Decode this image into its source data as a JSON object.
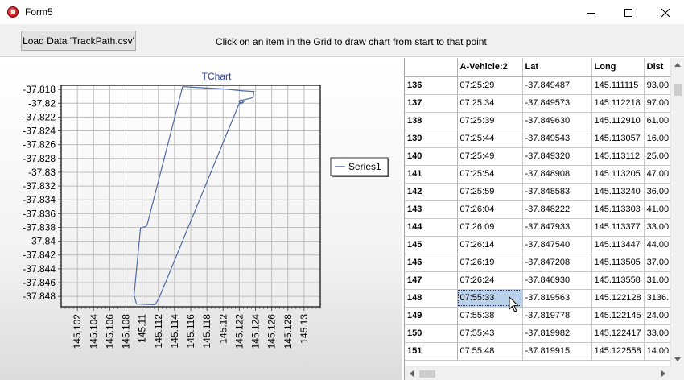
{
  "window": {
    "title": "Form5",
    "controls": {
      "minimize": "minimize-icon",
      "maximize": "maximize-icon",
      "close": "close-icon"
    }
  },
  "toolbar": {
    "load_label": "Load Data 'TrackPath.csv'",
    "hint": "Click on an item in the Grid to draw chart from start to that point"
  },
  "chart_data": {
    "type": "line",
    "title": "TChart",
    "legend": {
      "placement": "right",
      "entries": [
        "Series1"
      ]
    },
    "xlim": [
      145.1,
      145.132
    ],
    "ylim": [
      -37.8495,
      -37.8174
    ],
    "xticks": [
      "145.102",
      "145.104",
      "145.106",
      "145.108",
      "145.11",
      "145.112",
      "145.114",
      "145.116",
      "145.118",
      "145.12",
      "145.122",
      "145.124",
      "145.126",
      "145.128",
      "145.13"
    ],
    "yticks": [
      "-37.818",
      "-37.82",
      "-37.822",
      "-37.824",
      "-37.826",
      "-37.828",
      "-37.83",
      "-37.832",
      "-37.834",
      "-37.836",
      "-37.838",
      "-37.84",
      "-37.842",
      "-37.844",
      "-37.846",
      "-37.848"
    ],
    "grid": true,
    "line_color": "#4f6aa6",
    "series": [
      {
        "name": "Series1",
        "points": [
          [
            145.115,
            -37.8176
          ],
          [
            145.1198,
            -37.8179
          ],
          [
            145.1225,
            -37.8182
          ],
          [
            145.1238,
            -37.8183
          ],
          [
            145.1237,
            -37.8192
          ],
          [
            145.1222,
            -37.8196
          ],
          [
            145.1221,
            -37.82
          ],
          [
            145.1226,
            -37.8198
          ],
          [
            145.122,
            -37.82
          ],
          [
            145.1121,
            -37.8482
          ],
          [
            145.1116,
            -37.8492
          ],
          [
            145.1093,
            -37.8491
          ],
          [
            145.109,
            -37.8478
          ],
          [
            145.1098,
            -37.8381
          ],
          [
            145.1104,
            -37.8379
          ],
          [
            145.1106,
            -37.8377
          ],
          [
            145.115,
            -37.8176
          ]
        ]
      }
    ]
  },
  "grid": {
    "headers": [
      "",
      "A-Vehicle:2",
      "Lat",
      "Long",
      "Dist"
    ],
    "rows": [
      [
        "136",
        "07:25:29",
        "-37.849487",
        "145.111115",
        "93.00"
      ],
      [
        "137",
        "07:25:34",
        "-37.849573",
        "145.112218",
        "97.00"
      ],
      [
        "138",
        "07:25:39",
        "-37.849630",
        "145.112910",
        "61.00"
      ],
      [
        "139",
        "07:25:44",
        "-37.849543",
        "145.113057",
        "16.00"
      ],
      [
        "140",
        "07:25:49",
        "-37.849320",
        "145.113112",
        "25.00"
      ],
      [
        "141",
        "07:25:54",
        "-37.848908",
        "145.113205",
        "47.00"
      ],
      [
        "142",
        "07:25:59",
        "-37.848583",
        "145.113240",
        "36.00"
      ],
      [
        "143",
        "07:26:04",
        "-37.848222",
        "145.113303",
        "41.00"
      ],
      [
        "144",
        "07:26:09",
        "-37.847933",
        "145.113377",
        "33.00"
      ],
      [
        "145",
        "07:26:14",
        "-37.847540",
        "145.113447",
        "44.00"
      ],
      [
        "146",
        "07:26:19",
        "-37.847208",
        "145.113505",
        "37.00"
      ],
      [
        "147",
        "07:26:24",
        "-37.846930",
        "145.113558",
        "31.00"
      ],
      [
        "148",
        "07:55:33",
        "-37.819563",
        "145.122128",
        "3136."
      ],
      [
        "149",
        "07:55:38",
        "-37.819778",
        "145.122145",
        "24.00"
      ],
      [
        "150",
        "07:55:43",
        "-37.819982",
        "145.122417",
        "33.00"
      ],
      [
        "151",
        "07:55:48",
        "-37.819915",
        "145.122558",
        "14.00"
      ]
    ],
    "selected": {
      "row": 12,
      "col": 1
    }
  }
}
